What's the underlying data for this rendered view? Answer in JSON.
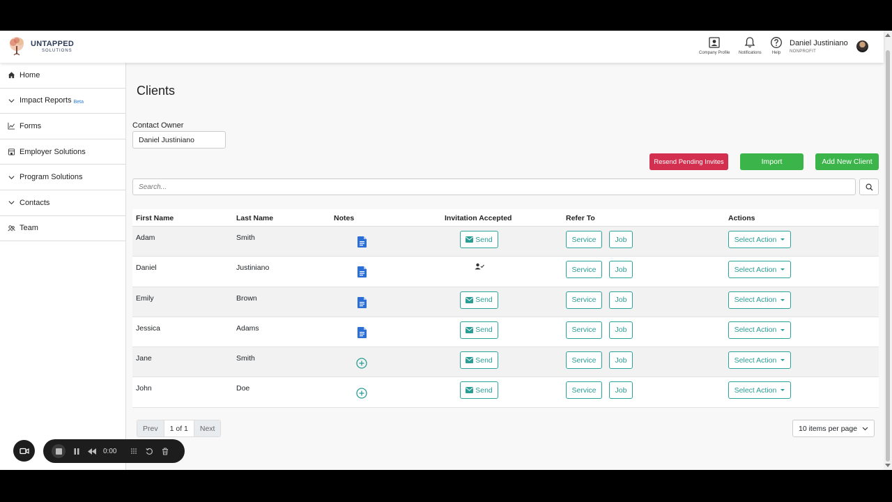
{
  "header": {
    "logo_title": "UNTAPPED",
    "logo_subtitle": "SOLUTIONS",
    "icons": [
      {
        "name": "company-profile",
        "label": "Company Profile"
      },
      {
        "name": "notifications",
        "label": "Notifications"
      },
      {
        "name": "help",
        "label": "Help"
      }
    ],
    "user_name": "Daniel Justiniano",
    "user_role": "NONPROFIT"
  },
  "sidebar": {
    "items": [
      {
        "label": "Home",
        "icon": "home-icon"
      },
      {
        "label": "Impact Reports",
        "icon": "chevron-down-icon",
        "badge": "Beta"
      },
      {
        "label": "Forms",
        "icon": "chart-icon"
      },
      {
        "label": "Employer Solutions",
        "icon": "building-icon"
      },
      {
        "label": "Program Solutions",
        "icon": "chevron-down-icon"
      },
      {
        "label": "Contacts",
        "icon": "chevron-down-icon"
      },
      {
        "label": "Team",
        "icon": "team-icon"
      }
    ]
  },
  "main": {
    "title": "Clients",
    "contact_owner_label": "Contact Owner",
    "contact_owner_value": "Daniel Justiniano",
    "buttons": {
      "resend": "Resend Pending Invites",
      "import": "Import",
      "add": "Add New Client"
    },
    "search_placeholder": "Search...",
    "columns": [
      "First Name",
      "Last Name",
      "Notes",
      "Invitation Accepted",
      "Refer To",
      "Actions"
    ],
    "rows": [
      {
        "first": "Adam",
        "last": "Smith",
        "notes": "document",
        "invite": "Send"
      },
      {
        "first": "Daniel",
        "last": "Justiniano",
        "notes": "document",
        "invite": "accepted"
      },
      {
        "first": "Emily",
        "last": "Brown",
        "notes": "document",
        "invite": "Send"
      },
      {
        "first": "Jessica",
        "last": "Adams",
        "notes": "document",
        "invite": "Send"
      },
      {
        "first": "Jane",
        "last": "Smith",
        "notes": "add",
        "invite": "Send"
      },
      {
        "first": "John",
        "last": "Doe",
        "notes": "add",
        "invite": "Send"
      }
    ],
    "refer_service": "Service",
    "refer_job": "Job",
    "action_label": "Select Action",
    "pager": {
      "prev": "Prev",
      "current": "1 of 1",
      "next": "Next"
    },
    "per_page": "10 items per page"
  },
  "recorder": {
    "time": "0:00"
  },
  "colors": {
    "accent_teal": "#2a9d94",
    "danger": "#d32f4f",
    "success": "#3bb54a",
    "doc_blue": "#2b6fd6"
  }
}
